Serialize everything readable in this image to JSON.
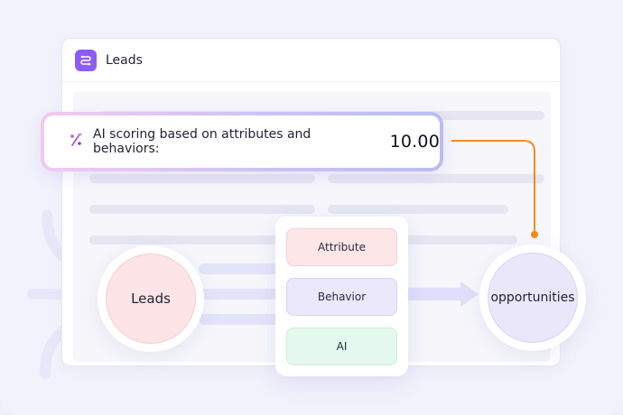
{
  "window": {
    "title": "Leads",
    "icon": "route-icon"
  },
  "scoring": {
    "icon": "percent-sparkle-icon",
    "label": "AI scoring based on attributes and behaviors:",
    "value": "10.00"
  },
  "source_node": {
    "label": "Leads"
  },
  "target_node": {
    "label": "opportunities"
  },
  "factors": [
    {
      "label": "Attribute",
      "color": "#fde6e8"
    },
    {
      "label": "Behavior",
      "color": "#ebe8fb"
    },
    {
      "label": "AI",
      "color": "#e5f8ee"
    }
  ],
  "colors": {
    "accent": "#8b5cf6",
    "connector": "#f58a1f",
    "flow": "#e6e6fb"
  }
}
